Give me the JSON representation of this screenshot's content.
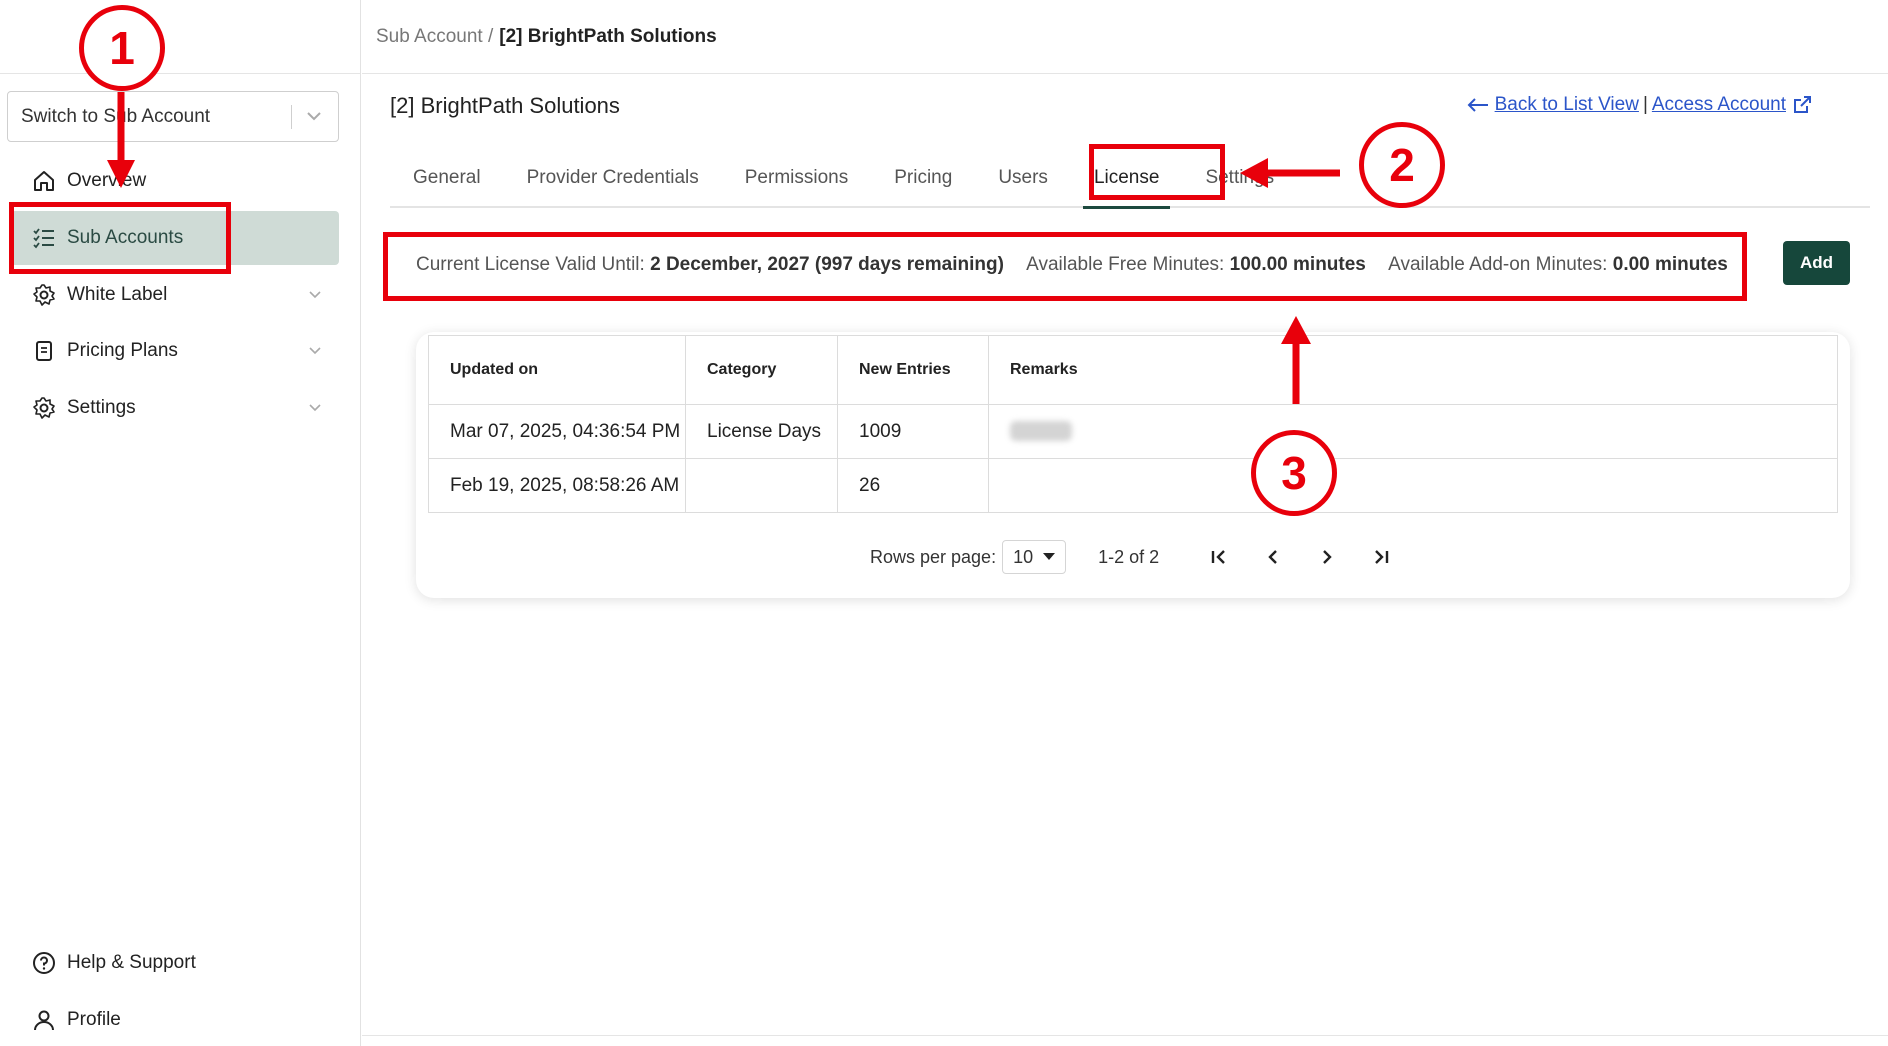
{
  "sidebar": {
    "switcher_label": "Switch to Sub Account",
    "items": [
      {
        "label": "Overview",
        "icon": "home-icon"
      },
      {
        "label": "Sub Accounts",
        "icon": "checklist-icon"
      },
      {
        "label": "White Label",
        "icon": "gear-icon"
      },
      {
        "label": "Pricing Plans",
        "icon": "document-icon"
      },
      {
        "label": "Settings",
        "icon": "gear-icon"
      }
    ],
    "bottom_items": [
      {
        "label": "Help & Support",
        "icon": "help-icon"
      },
      {
        "label": "Profile",
        "icon": "user-icon"
      }
    ]
  },
  "breadcrumb": {
    "parent": "Sub Account /",
    "current": "[2] BrightPath Solutions"
  },
  "page": {
    "title": "[2] BrightPath Solutions",
    "back_link": "Back to List View",
    "separator": "|",
    "access_link": "Access Account"
  },
  "tabs": [
    "General",
    "Provider Credentials",
    "Permissions",
    "Pricing",
    "Users",
    "License",
    "Settings"
  ],
  "license": {
    "valid_label": "Current License Valid Until:",
    "valid_value": "2 December, 2027 (997 days remaining)",
    "free_label": "Available Free Minutes:",
    "free_value": "100.00 minutes",
    "addon_label": "Available Add-on Minutes:",
    "addon_value": "0.00 minutes",
    "add_button": "Add"
  },
  "table": {
    "columns": [
      "Updated on",
      "Category",
      "New Entries",
      "Remarks"
    ],
    "rows": [
      [
        "Mar 07, 2025, 04:36:54 PM",
        "License Days",
        "1009",
        ""
      ],
      [
        "Feb 19, 2025, 08:58:26 AM",
        "",
        "26",
        ""
      ]
    ]
  },
  "pagination": {
    "rows_label": "Rows per page:",
    "rows_value": "10",
    "range": "1-2 of 2"
  },
  "annotations": {
    "badge_1": "1",
    "badge_2": "2",
    "badge_3": "3",
    "color": "#e8000b"
  },
  "colors": {
    "accent": "#16473b",
    "active_nav_bg": "#cfdbd6",
    "link": "#2b55c9"
  }
}
